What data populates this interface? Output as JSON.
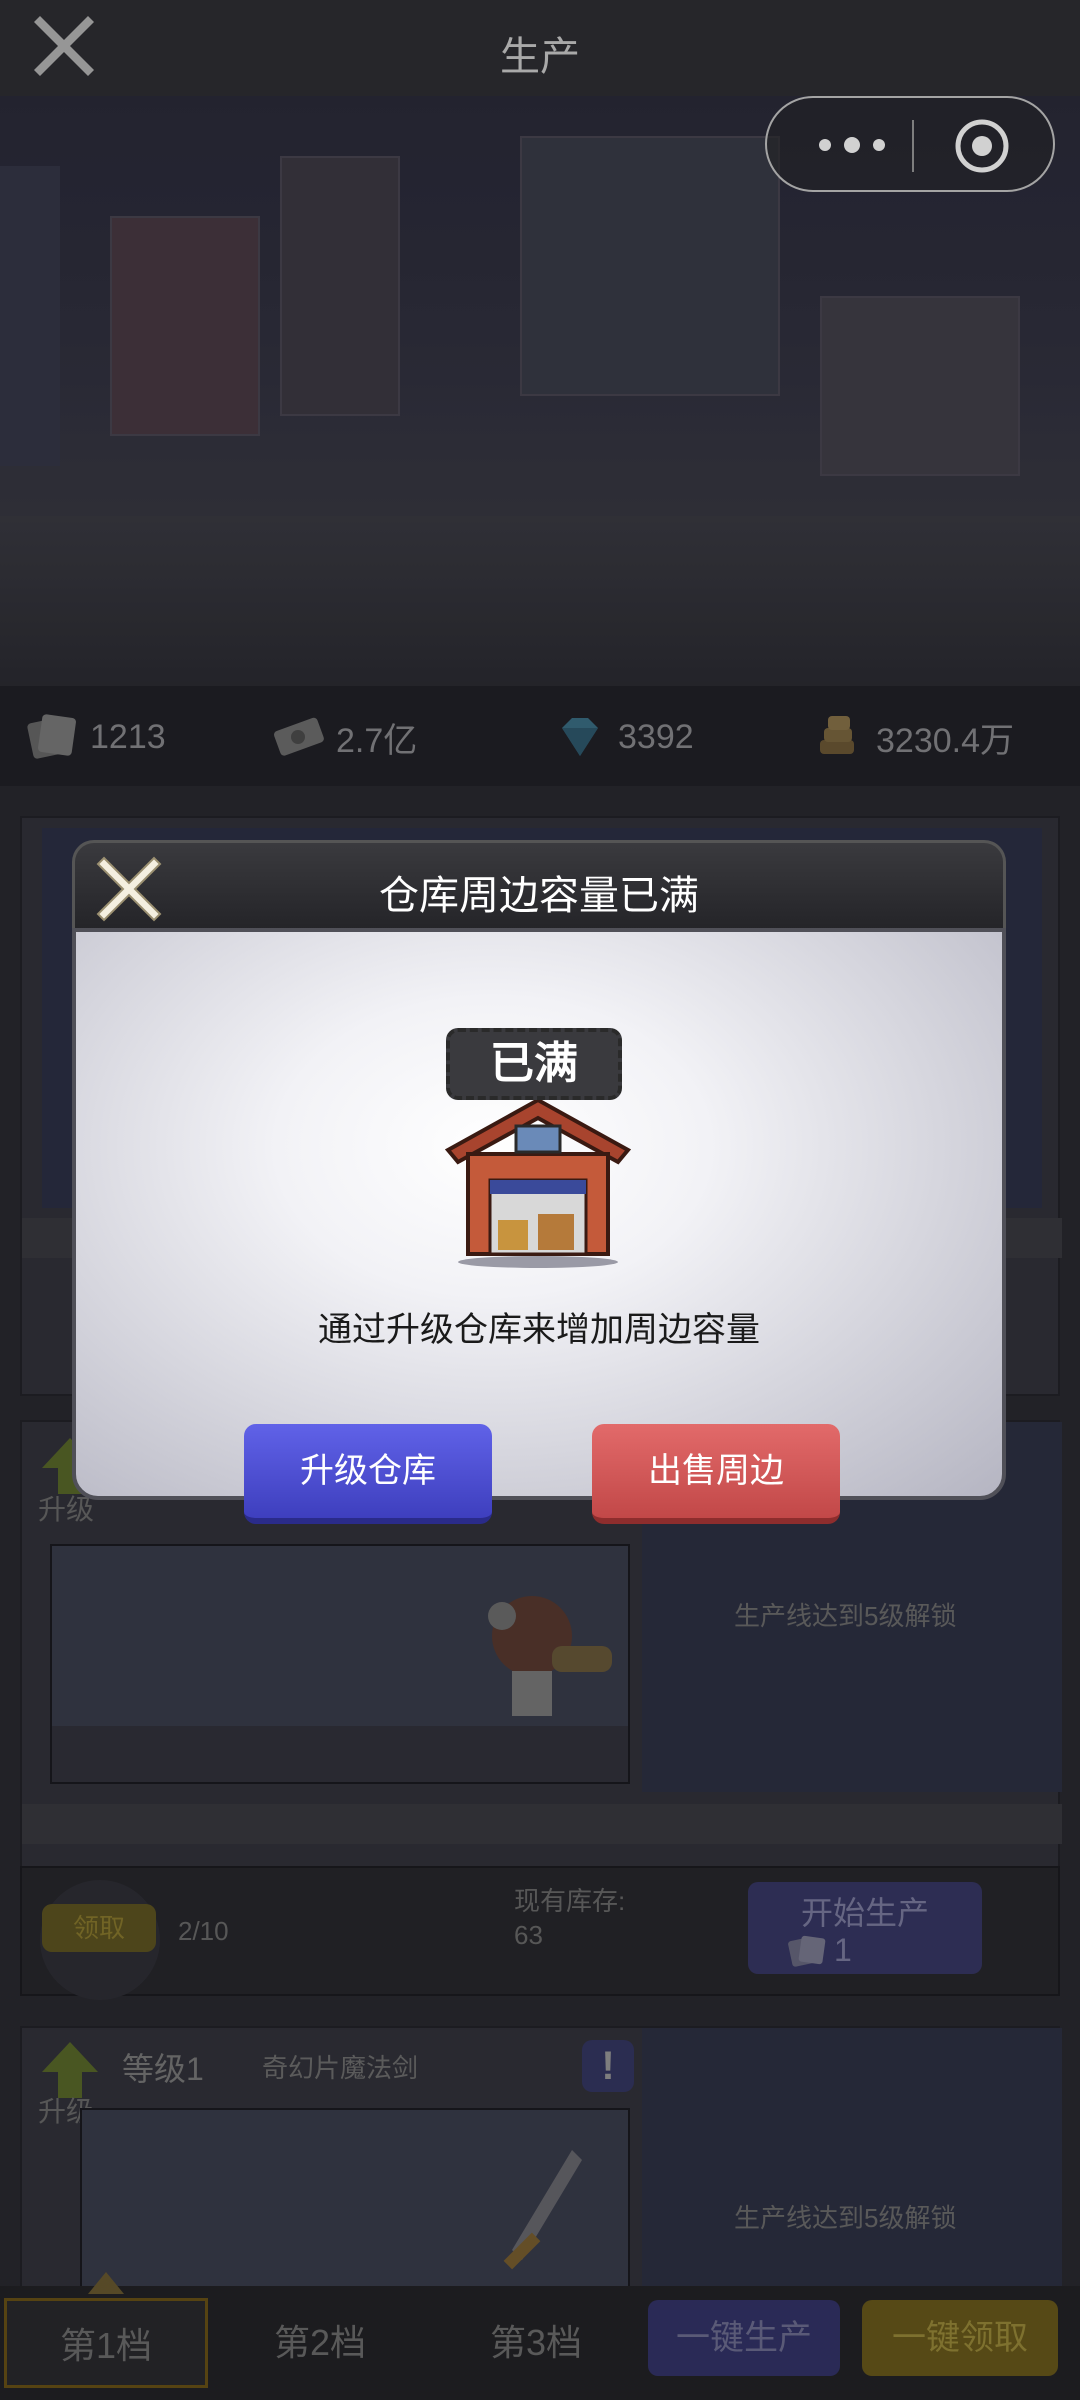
{
  "topbar": {
    "title": "生产"
  },
  "resources": [
    {
      "icon": "ticket-icon",
      "value": "1213"
    },
    {
      "icon": "cash-icon",
      "value": "2.7亿"
    },
    {
      "icon": "diamond-icon",
      "value": "3392"
    },
    {
      "icon": "coins-icon",
      "value": "3230.4万"
    }
  ],
  "cards": {
    "line2": {
      "upgrade_label": "升级",
      "lock_text": "生产线达到5级解锁"
    },
    "line3": {
      "upgrade_label": "升级",
      "level": "等级1",
      "item_name": "奇幻片魔法剑",
      "lock_text": "生产线达到5级解锁"
    }
  },
  "claim_row": {
    "claim_label": "领取",
    "count": "2/10",
    "stock_label": "现有库存:",
    "stock_value": "63",
    "start_label": "开始生产",
    "start_cost": "1"
  },
  "bottom_nav": {
    "tabs": [
      "第1档",
      "第2档",
      "第3档"
    ],
    "produce_all": "一键生产",
    "claim_all": "一键领取"
  },
  "dialog": {
    "title": "仓库周边容量已满",
    "tag": "已满",
    "message": "通过升级仓库来增加周边容量",
    "upgrade_button": "升级仓库",
    "sell_button": "出售周边"
  },
  "colors": {
    "upgrade_blue": "#4a4cd6",
    "sell_red": "#d35656",
    "claim_gold": "#e0c234"
  }
}
